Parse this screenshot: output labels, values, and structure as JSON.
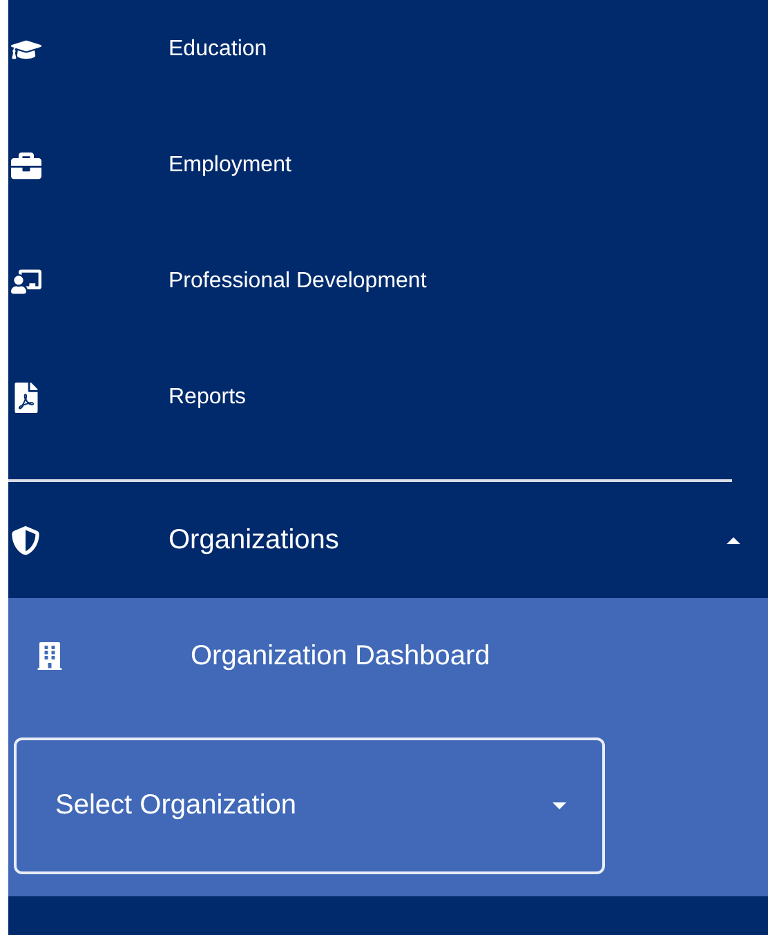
{
  "nav_items": [
    {
      "label": "Education"
    },
    {
      "label": "Employment"
    },
    {
      "label": "Professional Development"
    },
    {
      "label": "Reports"
    }
  ],
  "organizations": {
    "label": "Organizations",
    "expanded": true,
    "children": [
      {
        "label": "Organization Dashboard"
      }
    ],
    "select": {
      "placeholder": "Select Organization"
    }
  }
}
